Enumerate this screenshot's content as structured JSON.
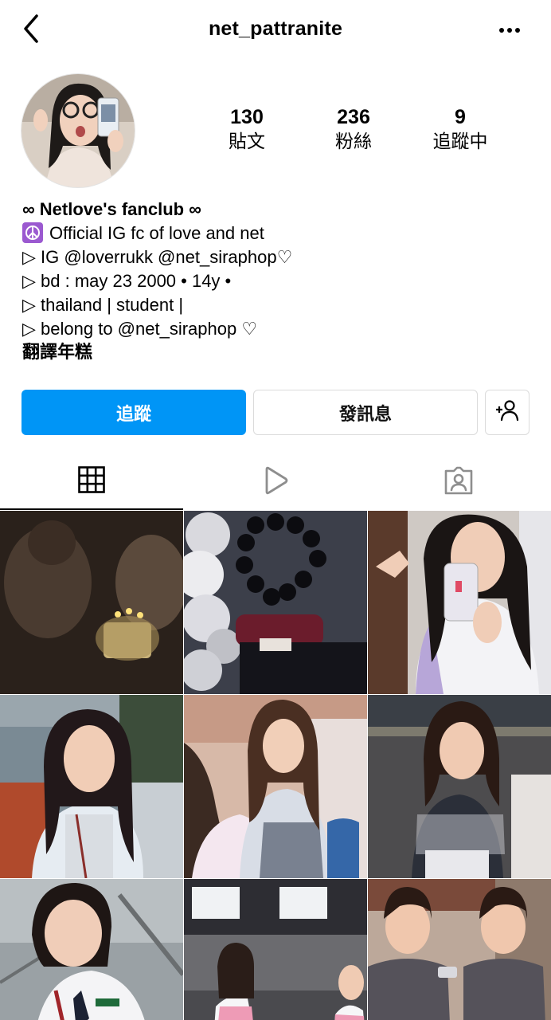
{
  "nav": {
    "username": "net_pattranite",
    "back_icon": "chevron-left-icon",
    "more_icon": "more-horizontal-icon"
  },
  "profile": {
    "stats": {
      "posts_count": "130",
      "posts_label": "貼文",
      "followers_count": "236",
      "followers_label": "粉絲",
      "following_count": "9",
      "following_label": "追蹤中"
    },
    "bio": {
      "name": "∞ Netlove's fanclub ∞",
      "line1": "Official IG fc of love and net",
      "line2": "▷ IG @loverrukk @net_siraphop♡",
      "line3": "▷ bd : may 23 2000 • 14y •",
      "line4": "▷ thailand | student |",
      "line5": "▷ belong to @net_siraphop ♡",
      "translate": "翻譯年糕"
    }
  },
  "actions": {
    "follow_label": "追蹤",
    "message_label": "發訊息",
    "add_user_icon": "add-user-icon"
  },
  "tabs": [
    {
      "icon": "grid-icon"
    },
    {
      "icon": "reels-icon"
    },
    {
      "icon": "tagged-icon"
    }
  ],
  "colors": {
    "follow_button": "#0095f6",
    "peace_badge": "#9b59d0"
  }
}
